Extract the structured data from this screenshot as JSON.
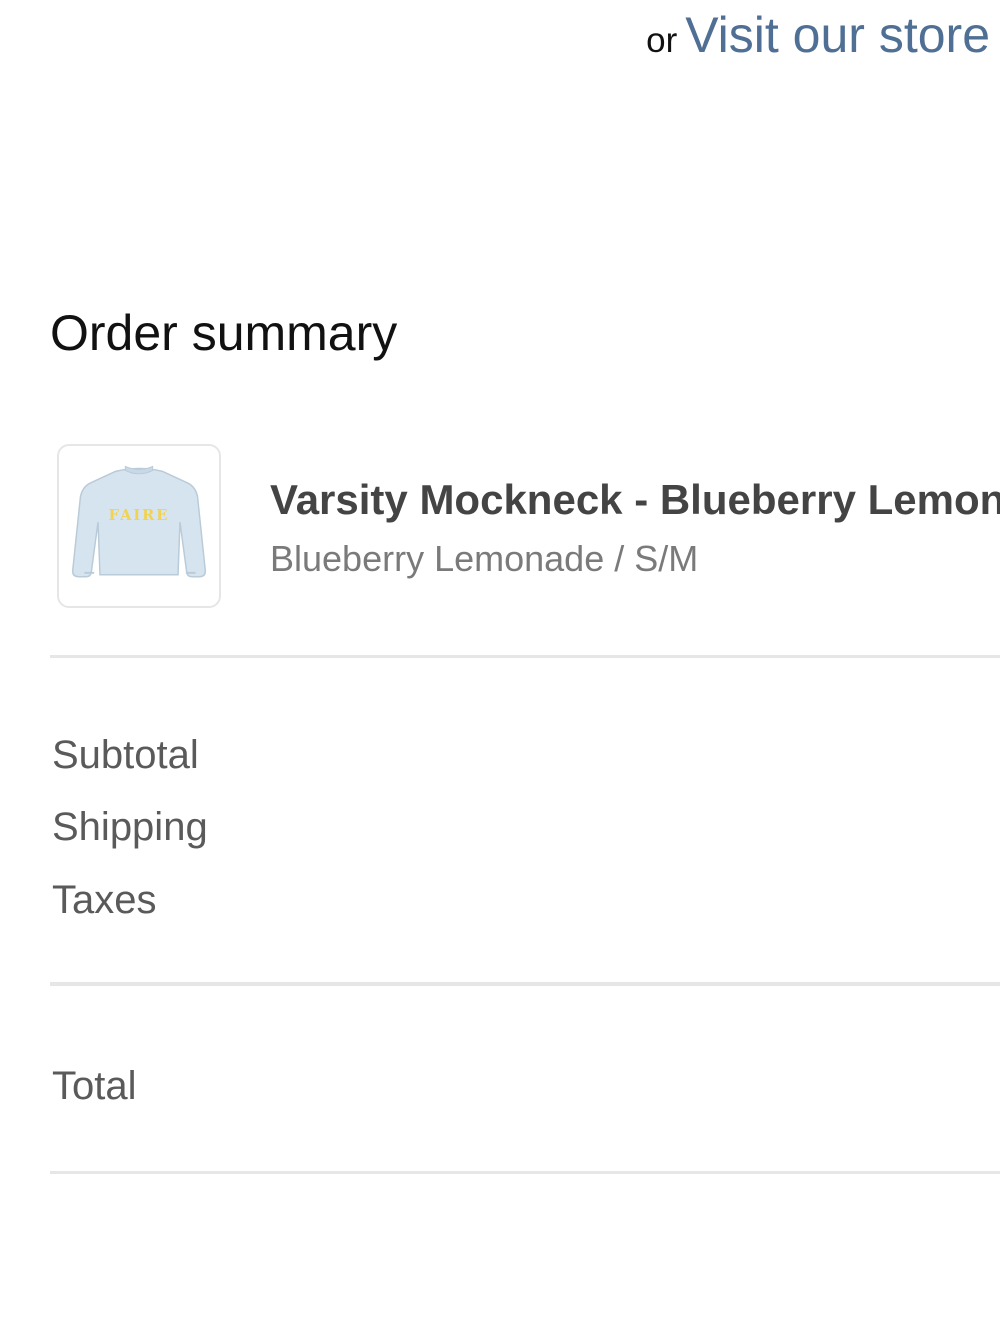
{
  "header": {
    "or_text": "or",
    "store_link_label": "Visit our store"
  },
  "order_summary": {
    "title": "Order summary",
    "item": {
      "name": "Varsity Mockneck - Blueberry Lemonade",
      "variant": "Blueberry Lemonade / S/M",
      "thumbnail": {
        "icon": "sweatshirt-icon",
        "graphic_text": "FAIRE",
        "sweater_color": "#d6e4ef",
        "lettering_color": "#f2d24f"
      }
    },
    "costs": {
      "subtotal_label": "Subtotal",
      "shipping_label": "Shipping",
      "taxes_label": "Taxes",
      "total_label": "Total"
    }
  },
  "colors": {
    "link": "#4f6f95",
    "title": "#111111",
    "muted_text": "#7a7a7a",
    "divider": "#e6e6e6"
  }
}
